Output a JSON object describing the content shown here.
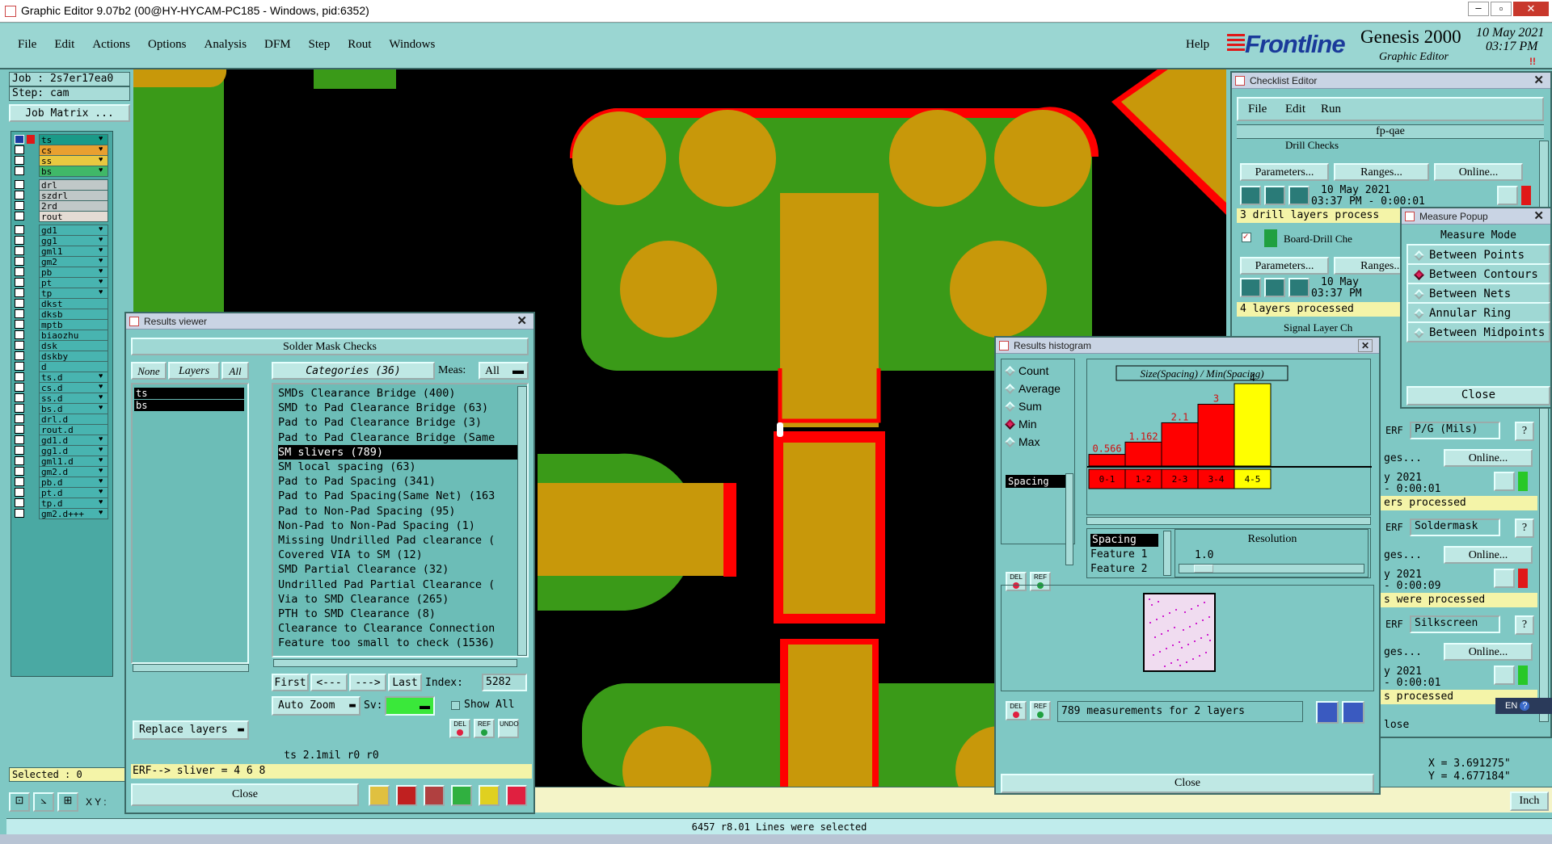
{
  "window": {
    "title": "Graphic Editor 9.07b2 (00@HY-HYCAM-PC185 - Windows, pid:6352)"
  },
  "menubar": {
    "items": [
      "File",
      "Edit",
      "Actions",
      "Options",
      "Analysis",
      "DFM",
      "Step",
      "Rout",
      "Windows"
    ],
    "help": "Help"
  },
  "brand": {
    "logo": "Frontline",
    "product": "Genesis 2000",
    "subtitle": "Graphic Editor",
    "date": "10 May 2021",
    "time": "03:17 PM"
  },
  "left_panel": {
    "job": "Job : 2s7er17ea0",
    "step": "Step: cam",
    "job_matrix": "Job Matrix ...",
    "selected": "Selected : 0",
    "xy_label": "X Y :",
    "layers": [
      {
        "name": "ts",
        "color": "#1a9a88",
        "check": true,
        "mark": "♥"
      },
      {
        "name": "cs",
        "color": "#e8a030",
        "check": false,
        "mark": "♥"
      },
      {
        "name": "ss",
        "color": "#e8c840",
        "check": false,
        "mark": "♥"
      },
      {
        "name": "bs",
        "color": "#40b868",
        "check": false,
        "mark": "♥"
      },
      {
        "name": "drl",
        "color": "#c0c8c8",
        "check": false,
        "mark": ""
      },
      {
        "name": "szdrl",
        "color": "#c0c8c8",
        "check": false,
        "mark": ""
      },
      {
        "name": "2rd",
        "color": "#c0c8c8",
        "check": false,
        "mark": ""
      },
      {
        "name": "rout",
        "color": "#e4dcd4",
        "check": false,
        "mark": ""
      },
      {
        "name": "gd1",
        "color": "#48b4b0",
        "check": false,
        "mark": "♥"
      },
      {
        "name": "gg1",
        "color": "#48b4b0",
        "check": false,
        "mark": "♥"
      },
      {
        "name": "gml1",
        "color": "#48b4b0",
        "check": false,
        "mark": "♥"
      },
      {
        "name": "gm2",
        "color": "#48b4b0",
        "check": false,
        "mark": "♥"
      },
      {
        "name": "pb",
        "color": "#48b4b0",
        "check": false,
        "mark": "♥"
      },
      {
        "name": "pt",
        "color": "#48b4b0",
        "check": false,
        "mark": "♥"
      },
      {
        "name": "tp",
        "color": "#48b4b0",
        "check": false,
        "mark": "♥"
      },
      {
        "name": "dkst",
        "color": "#48b4b0",
        "check": false,
        "mark": ""
      },
      {
        "name": "dksb",
        "color": "#48b4b0",
        "check": false,
        "mark": ""
      },
      {
        "name": "mptb",
        "color": "#48b4b0",
        "check": false,
        "mark": ""
      },
      {
        "name": "biaozhu",
        "color": "#48b4b0",
        "check": false,
        "mark": ""
      },
      {
        "name": "dsk",
        "color": "#48b4b0",
        "check": false,
        "mark": ""
      },
      {
        "name": "dskby",
        "color": "#48b4b0",
        "check": false,
        "mark": ""
      },
      {
        "name": "d",
        "color": "#48b4b0",
        "check": false,
        "mark": ""
      },
      {
        "name": "ts.d",
        "color": "#48b4b0",
        "check": false,
        "mark": "♥"
      },
      {
        "name": "cs.d",
        "color": "#48b4b0",
        "check": false,
        "mark": "♥"
      },
      {
        "name": "ss.d",
        "color": "#48b4b0",
        "check": false,
        "mark": "♥"
      },
      {
        "name": "bs.d",
        "color": "#48b4b0",
        "check": false,
        "mark": "♥"
      },
      {
        "name": "drl.d",
        "color": "#48b4b0",
        "check": false,
        "mark": ""
      },
      {
        "name": "rout.d",
        "color": "#48b4b0",
        "check": false,
        "mark": ""
      },
      {
        "name": "gd1.d",
        "color": "#48b4b0",
        "check": false,
        "mark": "♥"
      },
      {
        "name": "gg1.d",
        "color": "#48b4b0",
        "check": false,
        "mark": "♥"
      },
      {
        "name": "gml1.d",
        "color": "#48b4b0",
        "check": false,
        "mark": "♥"
      },
      {
        "name": "gm2.d",
        "color": "#48b4b0",
        "check": false,
        "mark": "♥"
      },
      {
        "name": "pb.d",
        "color": "#48b4b0",
        "check": false,
        "mark": "♥"
      },
      {
        "name": "pt.d",
        "color": "#48b4b0",
        "check": false,
        "mark": "♥"
      },
      {
        "name": "tp.d",
        "color": "#48b4b0",
        "check": false,
        "mark": "♥"
      },
      {
        "name": "gm2.d+++",
        "color": "#48b4b0",
        "check": false,
        "mark": "♥"
      }
    ]
  },
  "results_viewer": {
    "title": "Results viewer",
    "header": "Solder Mask Checks",
    "none": "None",
    "layers": "Layers",
    "all": "All",
    "categories": "Categories (36)",
    "meas_label": "Meas:",
    "meas_value": "All",
    "layer_list": [
      "ts",
      "bs"
    ],
    "category_list": [
      "SMDs Clearance Bridge (400)",
      "SMD to Pad Clearance Bridge (63)",
      "Pad to Pad Clearance Bridge (3)",
      "Pad to Pad Clearance Bridge (Same",
      "SM slivers (789)",
      "SM local spacing (63)",
      "Pad to Pad Spacing (341)",
      "Pad to Pad Spacing(Same Net) (163",
      "Pad to Non-Pad Spacing (95)",
      "Non-Pad to Non-Pad Spacing (1)",
      "Missing Undrilled Pad clearance (",
      "Covered VIA to SM (12)",
      "SMD Partial Clearance (32)",
      "Undrilled Pad Partial Clearance (",
      "Via to SMD Clearance (265)",
      "PTH to SMD Clearance (8)",
      "Clearance to Clearance Connection",
      "Feature too small to check (1536)"
    ],
    "selected_index": 4,
    "nav": {
      "first": "First",
      "prev": "<---",
      "next": "--->",
      "last": "Last",
      "index_label": "Index:",
      "index_value": "5282"
    },
    "auto_zoom": "Auto Zoom",
    "sv": "Sv:",
    "show_all": "Show All",
    "replace_layers": "Replace layers",
    "del": "DEL",
    "ref": "REF",
    "undo": "UNDO",
    "status": "ts 2.1mil  r0  r0",
    "erf": "ERF--> sliver = 4 6 8",
    "close": "Close"
  },
  "checklist": {
    "title": "Checklist Editor",
    "menu": [
      "File",
      "Edit",
      "Run"
    ],
    "name": "fp-qae",
    "row1_label": "Drill Checks",
    "erf": "ERF",
    "params": "Parameters...",
    "ranges": "Ranges...",
    "online": "Online...",
    "date1": "10 May 2021",
    "time1": "03:37 PM - 0:00:01",
    "msg1": "3 drill layers process",
    "row2_label": "Board-Drill Che",
    "date2": "10 May",
    "time2": "03:37 PM",
    "msg2": "4 layers processed",
    "row3_label": "Signal Layer Ch",
    "pg": "P/G (Mils)",
    "date3": "y 2021",
    "time3": "- 0:00:01",
    "msg3": "ers processed",
    "soldermask": "Soldermask",
    "date4": "y 2021",
    "time4": "- 0:00:09",
    "msg4": "s were processed",
    "silkscreen": "Silkscreen",
    "date5": "y 2021",
    "time5": "- 0:00:01",
    "msg5": "s processed",
    "close": "lose",
    "ges": "ges...",
    "q": "?"
  },
  "measure": {
    "title": "Measure Popup",
    "mode": "Measure Mode",
    "options": [
      "Between Points",
      "Between Contours",
      "Between Nets",
      "Annular Ring",
      "Between Midpoints"
    ],
    "selected": 1,
    "close": "Close"
  },
  "histogram": {
    "title": "Results histogram",
    "modes": [
      "Count",
      "Average",
      "Sum",
      "Min",
      "Max"
    ],
    "selected_mode": 3,
    "chart_title": "Size(Spacing) / Min(Spacing)",
    "list_item": "Spacing",
    "attr_list": [
      "Spacing",
      "Feature 1",
      "Feature 2"
    ],
    "resolution_label": "Resolution",
    "resolution_value": "1.0",
    "summary": "789 measurements for 2 layers",
    "close": "Close",
    "del": "DEL",
    "ref": "REF"
  },
  "chart_data": {
    "type": "bar",
    "title": "Size(Spacing) / Min(Spacing)",
    "categories": [
      "0-1",
      "1-2",
      "2-3",
      "3-4",
      "4-5"
    ],
    "values": [
      0.566,
      1.162,
      2.1,
      3,
      4
    ],
    "labels": [
      "0.566",
      "1.162",
      "2.1",
      "3",
      "4"
    ],
    "highlight": 4,
    "ylim": [
      0,
      4
    ],
    "bar_color": "#ff0000",
    "highlight_color": "#ffff00"
  },
  "coords": {
    "x": "X = 3.691275\"",
    "y": "Y = 4.677184\"",
    "units": "Inch"
  },
  "statusbar": {
    "text": "6457 r8.01 Lines were selected"
  },
  "lang": "EN"
}
